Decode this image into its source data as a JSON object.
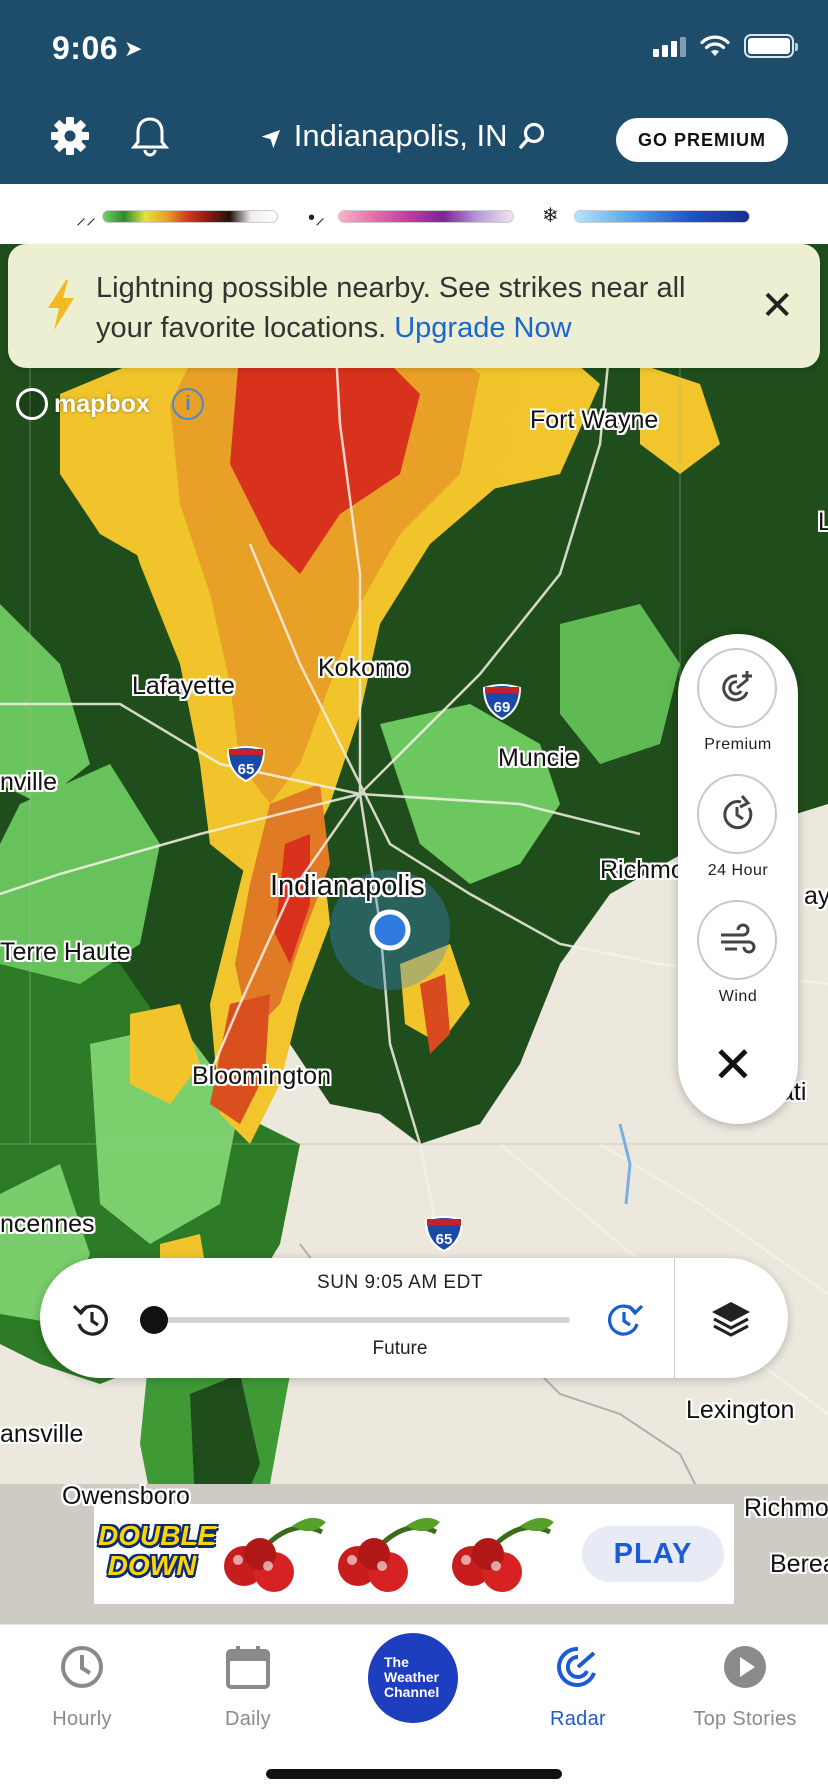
{
  "status_bar": {
    "time": "9:06"
  },
  "header": {
    "location": "Indianapolis, IN",
    "premium_button": "GO PREMIUM"
  },
  "banner": {
    "text": "Lightning possible nearby. See strikes near all your favorite locations.",
    "link": "Upgrade Now"
  },
  "map": {
    "attribution": "mapbox",
    "cities": {
      "fort_wayne": "Fort Wayne",
      "kokomo": "Kokomo",
      "lafayette": "Lafayette",
      "muncie": "Muncie",
      "nville": "nville",
      "indianapolis": "Indianapolis",
      "richmond_partial": "Richmo",
      "terre_haute": "Terre Haute",
      "bloomington": "Bloomington",
      "ati": "ati",
      "ay": "ay",
      "vincennes": "ncennes",
      "lexington": "Lexington",
      "evansville": "ansville",
      "owensboro": "Owensboro",
      "richmond_ky": "Richmo",
      "berea": "Berea",
      "l_edge": "L"
    },
    "shields": {
      "i69": "69",
      "i65_north": "65",
      "i65_south": "65"
    }
  },
  "side_panel": {
    "premium_label": "Premium",
    "hour24_label": "24 Hour",
    "wind_label": "Wind"
  },
  "timeline": {
    "timestamp": "SUN 9:05 AM EDT",
    "mode": "Future",
    "progress": 0.0
  },
  "ad": {
    "brand_line1": "DOUBLE",
    "brand_line2": "DOWN",
    "cta": "PLAY"
  },
  "nav": {
    "hourly": "Hourly",
    "daily": "Daily",
    "logo_line1": "The",
    "logo_line2": "Weather",
    "logo_line3": "Channel",
    "radar": "Radar",
    "top_stories": "Top Stories"
  },
  "colors": {
    "header_bg": "#1e4d6b",
    "accent_blue": "#1c5ad6",
    "banner_bg": "#ecefd2",
    "radar_heavy": "#d8311c",
    "radar_moderate": "#f0c42a",
    "radar_light": "#1f4d1b"
  }
}
